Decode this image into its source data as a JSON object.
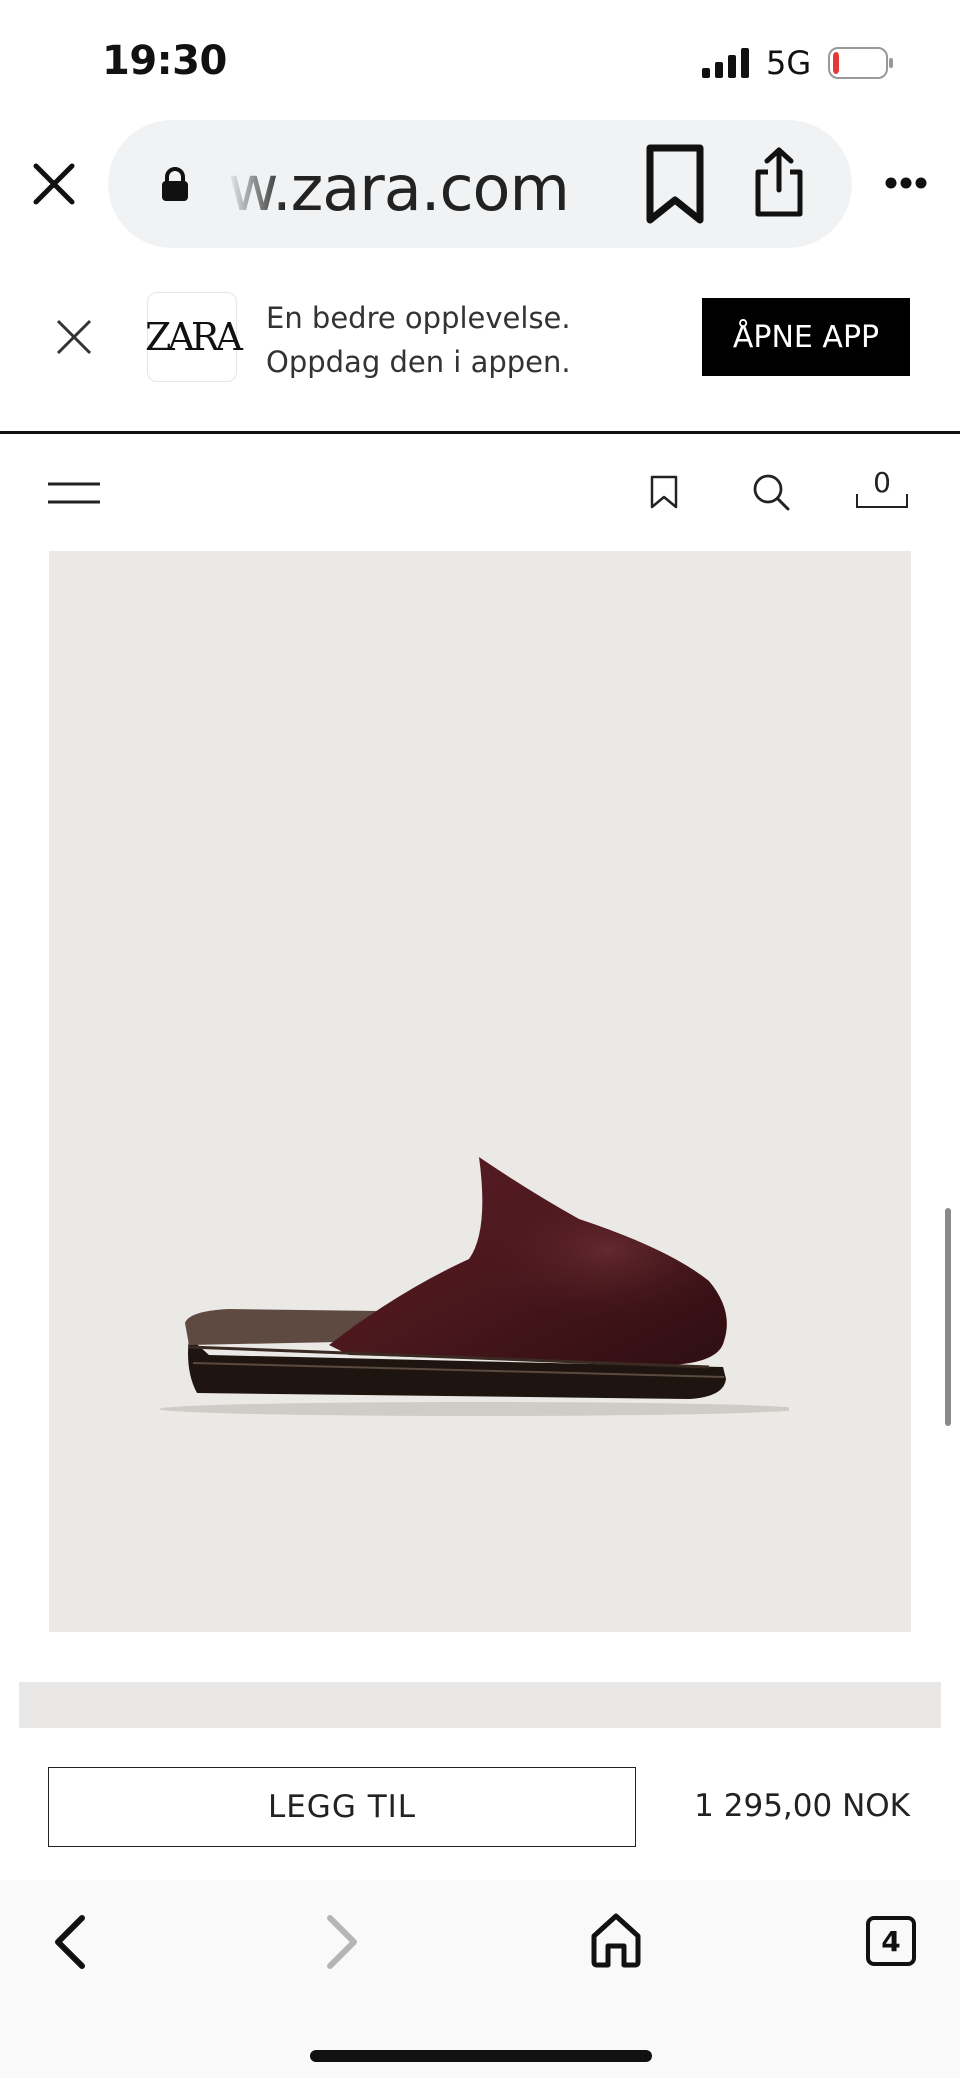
{
  "status_bar": {
    "time": "19:30",
    "network": "5G",
    "battery_level": 0.12,
    "battery_low_color": "#e53935"
  },
  "browser": {
    "url": "w.zara.com",
    "open_tabs": "4",
    "icons": [
      "close-icon",
      "lock-icon",
      "bookmark-icon",
      "share-icon",
      "more-icon",
      "back-icon",
      "forward-icon",
      "home-icon",
      "tabs-icon"
    ]
  },
  "app_banner": {
    "logo_text": "ZARA",
    "line1": "En bedre opplevelse.",
    "line2": "Oppdag den i appen.",
    "open_app_label": "ÅPNE APP"
  },
  "site_header": {
    "cart_count": "0",
    "icons": [
      "menu-icon",
      "bookmark-icon",
      "search-icon",
      "cart-icon"
    ]
  },
  "product": {
    "image_background": "#ebe9e6",
    "add_label": "LEGG TIL",
    "price": "1 295,00 NOK"
  }
}
